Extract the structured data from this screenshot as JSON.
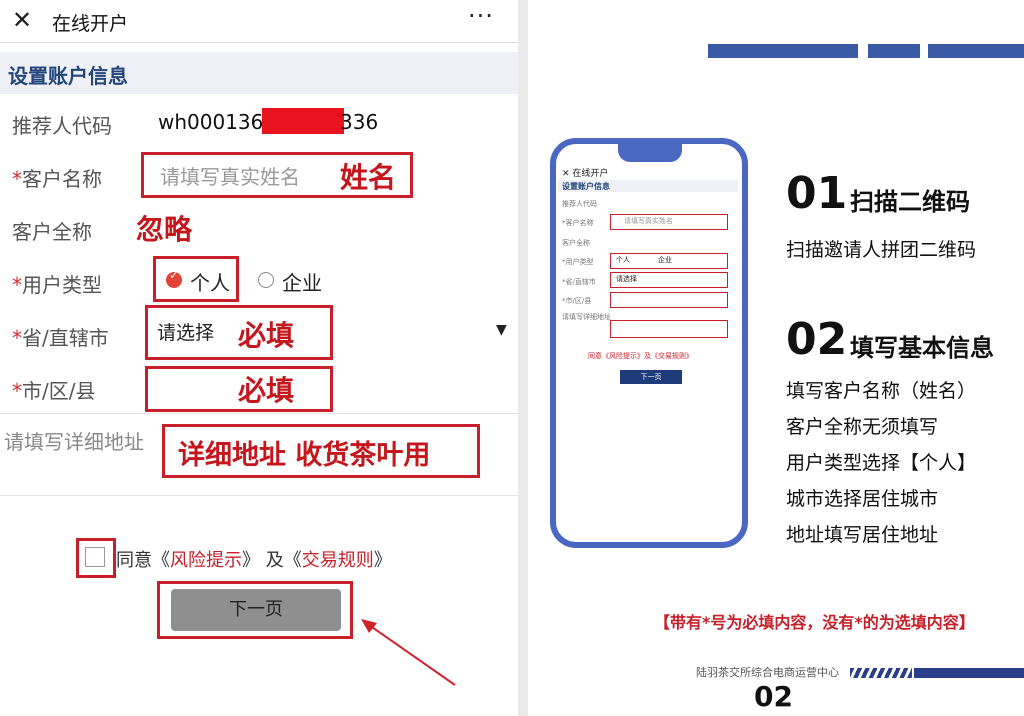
{
  "phone": {
    "close_icon": "close-icon",
    "title": "在线开户",
    "more": "···",
    "section_title": "设置账户信息",
    "rows": {
      "referrer_label": "推荐人代码",
      "referrer_value_start": "wh000136",
      "referrer_value_end": "336",
      "name_label": "客户名称",
      "name_placeholder": "请填写真实姓名",
      "fullname_label": "客户全称",
      "usertype_label": "用户类型",
      "usertype_personal": "个人",
      "usertype_company": "企业",
      "province_label": "省/直辖市",
      "province_value": "请选择",
      "city_label": "市/区/县",
      "address_placeholder": "请填写详细地址"
    },
    "star": "*",
    "agree_text": "同意《",
    "risk_link": "风险提示",
    "agree_mid": "》 及《",
    "rules_link": "交易规则",
    "agree_end": "》",
    "next_button": "下一页"
  },
  "annotations": {
    "name": "姓名",
    "fullname": "忽略",
    "province": "必填",
    "city": "必填",
    "address": "详细地址 收货茶叶用"
  },
  "guide": {
    "step1_num": "01",
    "step1_title": "扫描二维码",
    "step1_desc": "扫描邀请人拼团二维码",
    "step2_num": "02",
    "step2_title": "填写基本信息",
    "step2_items": [
      "填写客户名称（姓名）",
      "客户全称无须填写",
      "用户类型选择【个人】",
      "城市选择居住城市",
      "地址填写居住地址"
    ],
    "notice": "【带有*号为必填内容，没有*的为选填内容】",
    "footer": "陆羽茶交所综合电商运营中心",
    "page_num": "02"
  },
  "mini": {
    "title": "在线开户",
    "section": "设置账户信息",
    "labels": [
      "推荐人代码",
      "*客户名称",
      "客户全称",
      "*用户类型",
      "*省/直辖市",
      "*市/区/县"
    ],
    "name_placeholder": "请填写真实姓名",
    "personal": "个人",
    "company": "企业",
    "province_value": "请选择",
    "address": "请填写详细地址",
    "agree": "同意《风险提示》及《交易规则》",
    "next": "下一页"
  },
  "colors": {
    "accent_red": "#c8202a",
    "brand_blue": "#3b5aa6",
    "section_text": "#23467a"
  }
}
